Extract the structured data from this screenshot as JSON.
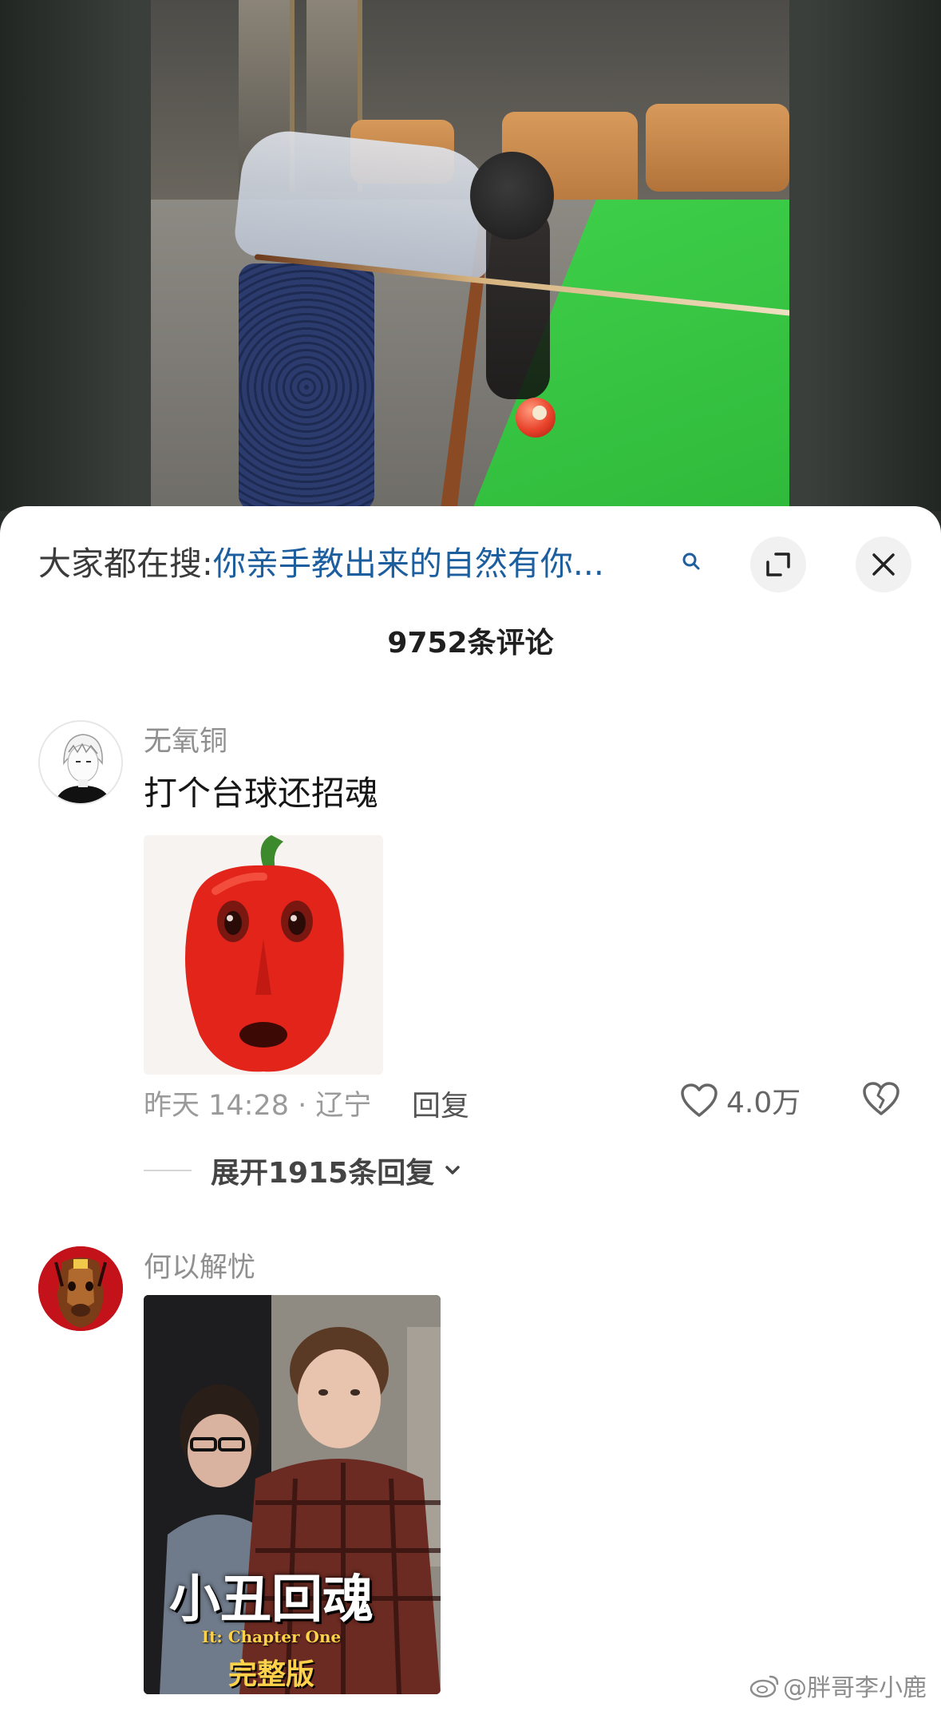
{
  "video": {
    "description_icon": "billiards-video-frame"
  },
  "sheet": {
    "search_prefix": "大家都在搜:",
    "search_query": "你亲手教出来的自然有你...",
    "comment_count": "9752条评论"
  },
  "comments": [
    {
      "username": "无氧铜",
      "text": "打个台球还招魂",
      "meta": "昨天 14:28 · 辽宁",
      "reply_label": "回复",
      "likes": "4.0万",
      "expand_label": "展开1915条回复"
    },
    {
      "username": "何以解忧",
      "thumb_title": "小丑回魂",
      "thumb_subtitle": "It: Chapter One",
      "thumb_tag": "完整版"
    }
  ],
  "watermark": "@胖哥李小鹿",
  "colors": {
    "search_query": "#1d5f9e",
    "username": "#8f8f8f",
    "felt_green": "#34c13e"
  }
}
